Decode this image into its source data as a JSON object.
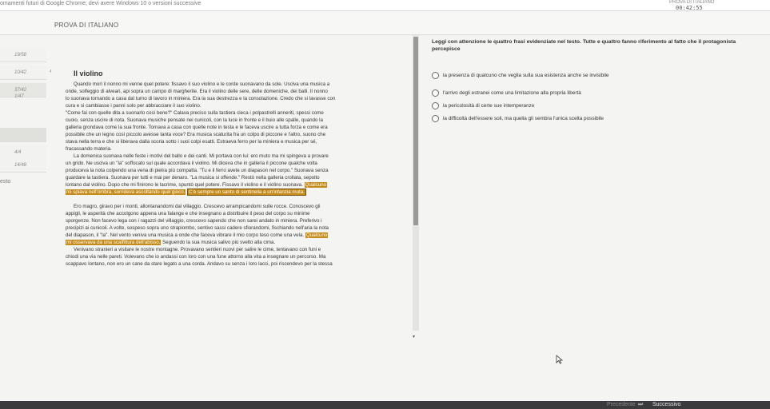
{
  "topbar": {
    "notice": "omamenti futuri di Google Chrome; devi avere Windows 10 o versioni successive",
    "brand": "PROVA DI ITALIANO",
    "timer": "00:42:55"
  },
  "header": {
    "test_title": "PROVA DI ITALIANO"
  },
  "sidebar": {
    "items": [
      {
        "label": "19/58"
      },
      {
        "label": "10/42"
      },
      {
        "label": "37/42"
      },
      {
        "label": "1/47"
      },
      {
        "label": ""
      },
      {
        "label": "4/4"
      },
      {
        "label": "14/48"
      }
    ],
    "bottom_label": "esto"
  },
  "passage": {
    "title": "Il violino",
    "lines": [
      {
        "segments": [
          {
            "text": "Quando morì il nonno mi venne quel potere: fissavo il suo violino e le corde suonavano da sole. Usciva una musica a"
          }
        ]
      },
      {
        "segments": [
          {
            "text": "onde, solfeggio di alveari, api sopra un campo di margherite. Era il violino delle sere, delle domeniche, dei balli. Il nonno"
          }
        ]
      },
      {
        "segments": [
          {
            "text": "lo suonava tornando a casa dal turno di lavoro in miniera. Era la sua destrezza e la consolazione. Credo che si lavasse con"
          }
        ]
      },
      {
        "segments": [
          {
            "text": "cura e si cambiasse i panni solo per abbracciare il suo violino."
          }
        ]
      },
      {
        "segments": [
          {
            "text": "\"Come fai con quelle dita a suonarlo così bene?\" Calava preciso sulla tastiera cieca i polpastrelli anneriti, spessi come"
          }
        ]
      },
      {
        "segments": [
          {
            "text": "cuoio, senza uscire di nota. Suonava musiche pensate nei cunicoli, con la luce in fronte e il buio alle spalle, quando la"
          }
        ]
      },
      {
        "segments": [
          {
            "text": "galleria grondava come la sua fronte. Tornava a casa con quelle note in testa e le faceva uscire a tutta forza e come era"
          }
        ]
      },
      {
        "segments": [
          {
            "text": "possibile che un legno così piccolo avesse tanta voce? Era musica scaturita fra un colpo di piccone e l'altro, suono che"
          }
        ]
      },
      {
        "segments": [
          {
            "text": "stava nella terra e che si liberava dalla scoria sotto i suoi colpi esatti. Estraeva ferro per la miniera e musica per sé,"
          }
        ]
      },
      {
        "segments": [
          {
            "text": "fracassando materia."
          }
        ]
      },
      {
        "segments": [
          {
            "text": "La domenica suonava nelle feste i motivi del ballo e dei canti. Mi portava con lui: ero muto ma mi spingeva a provare"
          }
        ]
      },
      {
        "segments": [
          {
            "text": "un grido. Ne usciva un \"la\" soffocato sul quale accordava il violino. Mi diceva che in galleria il piccone qualche volta"
          }
        ]
      },
      {
        "segments": [
          {
            "text": "produceva la nota colpendo una vena di pietra più compatta. \"Tu e il ferro avete un diapason  nel corpo.\" Suonava senza"
          }
        ]
      },
      {
        "segments": [
          {
            "text": "guardare la tastiera. Suonava per tutti e mai per denaro. \"La musica si offende.\" Restò nella galleria crollata, sepolto"
          }
        ]
      },
      {
        "segments": [
          {
            "text": "lontano dal violino. Dopo che mi finirono le lacrime, spuntò quel potere. Fissavo il violino e il violino suonava. "
          },
          {
            "text": "Qualcuno",
            "hl": true
          }
        ]
      },
      {
        "segments": [
          {
            "text": "mi spiava nell'ombra, sorrideva ascoltando quel gioco.",
            "hl": true
          },
          {
            "text": " "
          },
          {
            "text": "C'è sempre un santo di sentinella a un'infanzia muta.",
            "hl": true,
            "box": true
          }
        ]
      },
      {
        "segments": [
          {
            "text": ""
          }
        ]
      },
      {
        "segments": [
          {
            "text": "Ero magro, giravo per i monti, allontanandomi dal villaggio. Crescevo arrampicandomi sulle rocce. Conoscevo gli"
          }
        ]
      },
      {
        "segments": [
          {
            "text": "appigli, le asperità che accolgono appena una falange e che insegnano a distribuire il peso del corpo su minime"
          }
        ]
      },
      {
        "segments": [
          {
            "text": "sporgenze. Non facevo lega con i ragazzi del villaggio, crescevo sapendo che non sarei andato in miniera. Preferivo i"
          }
        ]
      },
      {
        "segments": [
          {
            "text": "precipizi ai cunicoli. A volte, sospeso sopra uno strapiombo, sentivo sassi cadere sfiorandomi, fischiando nell'aria la nota"
          }
        ]
      },
      {
        "segments": [
          {
            "text": "del diapason, il \"la\". Nel vento veniva una musica a onde che faceva vibrare il mio corpo teso come una vela. "
          },
          {
            "text": "Qualcuno",
            "hl": true
          }
        ]
      },
      {
        "segments": [
          {
            "text": "mi osservava da una scalfittura dell'abisso.",
            "hl": true
          },
          {
            "text": " Seguendo la sua musica salivo più svelto alla cima."
          }
        ]
      },
      {
        "segments": [
          {
            "text": "Venivano stranieri a visitare le nostre montagne. Provavano sentieri nuovi per salire le cime, tentavano con funi e"
          }
        ]
      },
      {
        "segments": [
          {
            "text": "chiodi una via nelle pareti. Volevano che io andassi con loro con una fune attorno alla vita a insegnare un percorso. Ma"
          }
        ]
      },
      {
        "segments": [
          {
            "text": "scappavo lontano, non ero un cane da stare legato a una corda. Andavo su senza i loro lacci, poi riscendevo per la stessa"
          }
        ]
      }
    ]
  },
  "question": {
    "text_line1": "Leggi con attenzione le quattro frasi evidenziate nel testo. Tutte e quattro fanno riferimento al fatto che il protagonista",
    "text_line2": "percepisce",
    "options": [
      {
        "label": "la presenza di qualcuno che veglia sulla sua esistenza anche se invisibile"
      },
      {
        "label": "l'arrivo degli estranei come una limitazione alla propria libertà"
      },
      {
        "label": "la pericolosità di certe sue intemperanze"
      },
      {
        "label": "la difficoltà dell'essere soli, ma quella gli sembra l'unica scelta possibile"
      }
    ]
  },
  "footer": {
    "prev_label": "Precedente",
    "skip_icon": "⏭",
    "next_label": "Successivo"
  }
}
